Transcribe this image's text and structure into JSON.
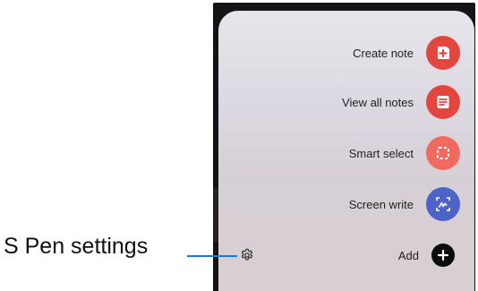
{
  "callout": {
    "label": "S Pen settings"
  },
  "menu": {
    "items": [
      {
        "label": "Create note",
        "icon": "create-note-icon",
        "color": "#e2463f"
      },
      {
        "label": "View all notes",
        "icon": "view-all-notes-icon",
        "color": "#e2463f"
      },
      {
        "label": "Smart select",
        "icon": "smart-select-icon",
        "color": "#f06a5f"
      },
      {
        "label": "Screen write",
        "icon": "screen-write-icon",
        "color": "#4d63c8"
      },
      {
        "label": "Add",
        "icon": "add-icon",
        "color": "#0c0c0c"
      }
    ],
    "settings_icon": "gear-icon"
  },
  "colors": {
    "panel_background": "#dcd8e1",
    "callout_line": "#1b7bd0"
  }
}
